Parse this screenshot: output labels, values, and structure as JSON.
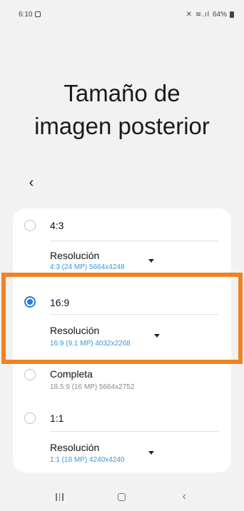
{
  "status_bar": {
    "time": "6:10",
    "icons": "✕ ≋.ıl",
    "battery": "64%"
  },
  "page": {
    "title_line1": "Tamaño de",
    "title_line2": "imagen posterior"
  },
  "back_button": {
    "glyph": "‹"
  },
  "options": [
    {
      "label": "4:3",
      "selected": false,
      "resolution_label": "Resolución",
      "resolution_value": "4:3 (24 MP) 5664x4248"
    },
    {
      "label": "16:9",
      "selected": true,
      "resolution_label": "Resolución",
      "resolution_value": "16:9 (9.1 MP) 4032x2268"
    },
    {
      "label": "Completa",
      "selected": false,
      "sublabel": "18.5:9 (16 MP) 5664x2752"
    },
    {
      "label": "1:1",
      "selected": false,
      "resolution_label": "Resolución",
      "resolution_value": "1:1 (18 MP) 4240x4240"
    }
  ],
  "colors": {
    "highlight": "#f08224",
    "accent": "#2a79e0",
    "resolution_text": "#3b96d4"
  },
  "nav_bar": {
    "recents_icon": "recents-icon",
    "home_icon": "home-icon",
    "back_icon": "back-icon",
    "back_glyph": "‹"
  }
}
